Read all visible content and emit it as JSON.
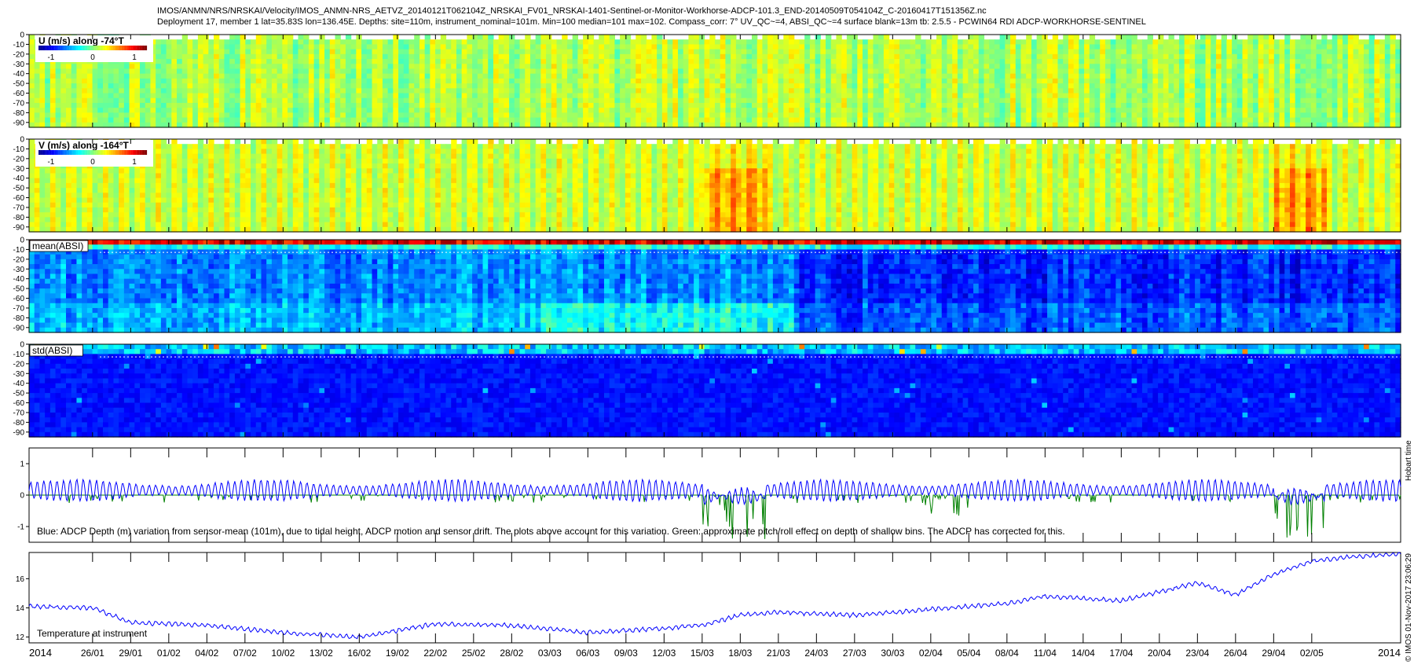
{
  "title_line1": "IMOS/ANMN/NRS/NRSKAI/Velocity/IMOS_ANMN-NRS_AETVZ_20140121T062104Z_NRSKAI_FV01_NRSKAI-1401-Sentinel-or-Monitor-Workhorse-ADCP-101.3_END-20140509T054104Z_C-20160417T151356Z.nc",
  "title_line2": "Deployment 17, member 1 lat=35.83S lon=136.45E. Depths: site=110m, instrument_nominal=101m. Min=100 median=101 max=102. Compass_corr: 7° UV_QC~=4, ABSI_QC~=4 surface blank=13m tb: 2.5.5 - PCWIN64 RDI ADCP-WORKHORSE-SENTINEL",
  "side_note": "© IMOS 01-Nov-2017 23:06:29",
  "side_hobart": "Hobart time",
  "colors": {
    "jet": [
      "#00008f",
      "#0000ff",
      "#0080ff",
      "#00ffff",
      "#80ff80",
      "#ffff00",
      "#ff8000",
      "#ff0000",
      "#800000"
    ],
    "line_blue": "#0000ff",
    "line_green": "#008000"
  },
  "chart_data": [
    {
      "type": "heatmap",
      "label": "U (m/s) along -74°T",
      "colorbar_ticks": [
        "-1",
        "0",
        "1"
      ],
      "clim": [
        -1.3,
        1.3
      ],
      "yticks": [
        "0",
        "-10",
        "-20",
        "-30",
        "-40",
        "-50",
        "-60",
        "-70",
        "-80",
        "-90"
      ],
      "ylim": [
        -95,
        0
      ],
      "mean_value": 0.05,
      "note": ""
    },
    {
      "type": "heatmap",
      "label": "V (m/s) along -164°T",
      "colorbar_ticks": [
        "-1",
        "0",
        "1"
      ],
      "clim": [
        -1.3,
        1.3
      ],
      "yticks": [
        "0",
        "-10",
        "-20",
        "-30",
        "-40",
        "-50",
        "-60",
        "-70",
        "-80",
        "-90"
      ],
      "ylim": [
        -95,
        0
      ],
      "mean_value": 0.2,
      "strong_periods": [
        [
          "15/03",
          "20/03"
        ],
        [
          "29/04",
          "03/05"
        ]
      ]
    },
    {
      "type": "heatmap",
      "label": "mean(ABSI)",
      "yticks": [
        "0",
        "-10",
        "-20",
        "-30",
        "-40",
        "-50",
        "-60",
        "-70",
        "-80",
        "-90"
      ],
      "ylim": [
        -95,
        0
      ]
    },
    {
      "type": "heatmap",
      "label": "std(ABSI)",
      "yticks": [
        "0",
        "-10",
        "-20",
        "-30",
        "-40",
        "-50",
        "-60",
        "-70",
        "-80",
        "-90"
      ],
      "ylim": [
        -95,
        0
      ]
    },
    {
      "type": "line",
      "annotation": "Blue: ADCP Depth (m) variation from sensor-mean (101m), due to tidal height, ADCP motion and sensor drift. The plots above account for this variation. Green: approximate pitch/roll effect on depth of shallow bins. The ADCP has corrected for this.",
      "yticks": [
        "1",
        "0",
        "-1"
      ],
      "ylim": [
        -1.5,
        1.5
      ],
      "series": [
        {
          "color": "blue",
          "amplitude": 0.3,
          "offset": 0.15
        },
        {
          "color": "green",
          "dips": [
            [
              "15/03",
              "20/03",
              -1.4
            ],
            [
              "01/04",
              "05/04",
              -0.8
            ],
            [
              "29/04",
              "03/05",
              -1.4
            ]
          ]
        }
      ]
    },
    {
      "type": "line",
      "annotation": "Temperature at instrument",
      "yticks": [
        "16",
        "14",
        "12"
      ],
      "ylim": [
        11.6,
        17.8
      ],
      "series": [
        {
          "color": "blue",
          "x": [
            "21/01",
            "26/01",
            "29/01",
            "04/02",
            "10/02",
            "16/02",
            "22/02",
            "28/02",
            "06/03",
            "12/03",
            "15/03",
            "18/03",
            "21/03",
            "27/03",
            "02/04",
            "08/04",
            "11/04",
            "17/04",
            "20/04",
            "23/04",
            "26/04",
            "29/04",
            "02/05",
            "05/05",
            "09/05"
          ],
          "y": [
            14.1,
            14.0,
            13.0,
            12.8,
            12.3,
            12.0,
            12.9,
            12.8,
            12.3,
            12.6,
            12.8,
            13.5,
            13.7,
            13.5,
            13.9,
            14.3,
            14.8,
            14.5,
            15.1,
            15.7,
            14.9,
            16.3,
            17.2,
            17.5,
            17.7
          ]
        }
      ]
    }
  ],
  "x_axis": {
    "start_label": "2014",
    "end_label": "2014",
    "ticks": [
      "26/01",
      "29/01",
      "01/02",
      "04/02",
      "07/02",
      "10/02",
      "13/02",
      "16/02",
      "19/02",
      "22/02",
      "25/02",
      "28/02",
      "03/03",
      "06/03",
      "09/03",
      "12/03",
      "15/03",
      "18/03",
      "21/03",
      "24/03",
      "27/03",
      "30/03",
      "02/04",
      "05/04",
      "08/04",
      "11/04",
      "14/04",
      "17/04",
      "20/04",
      "23/04",
      "26/04",
      "29/04",
      "02/05"
    ]
  }
}
